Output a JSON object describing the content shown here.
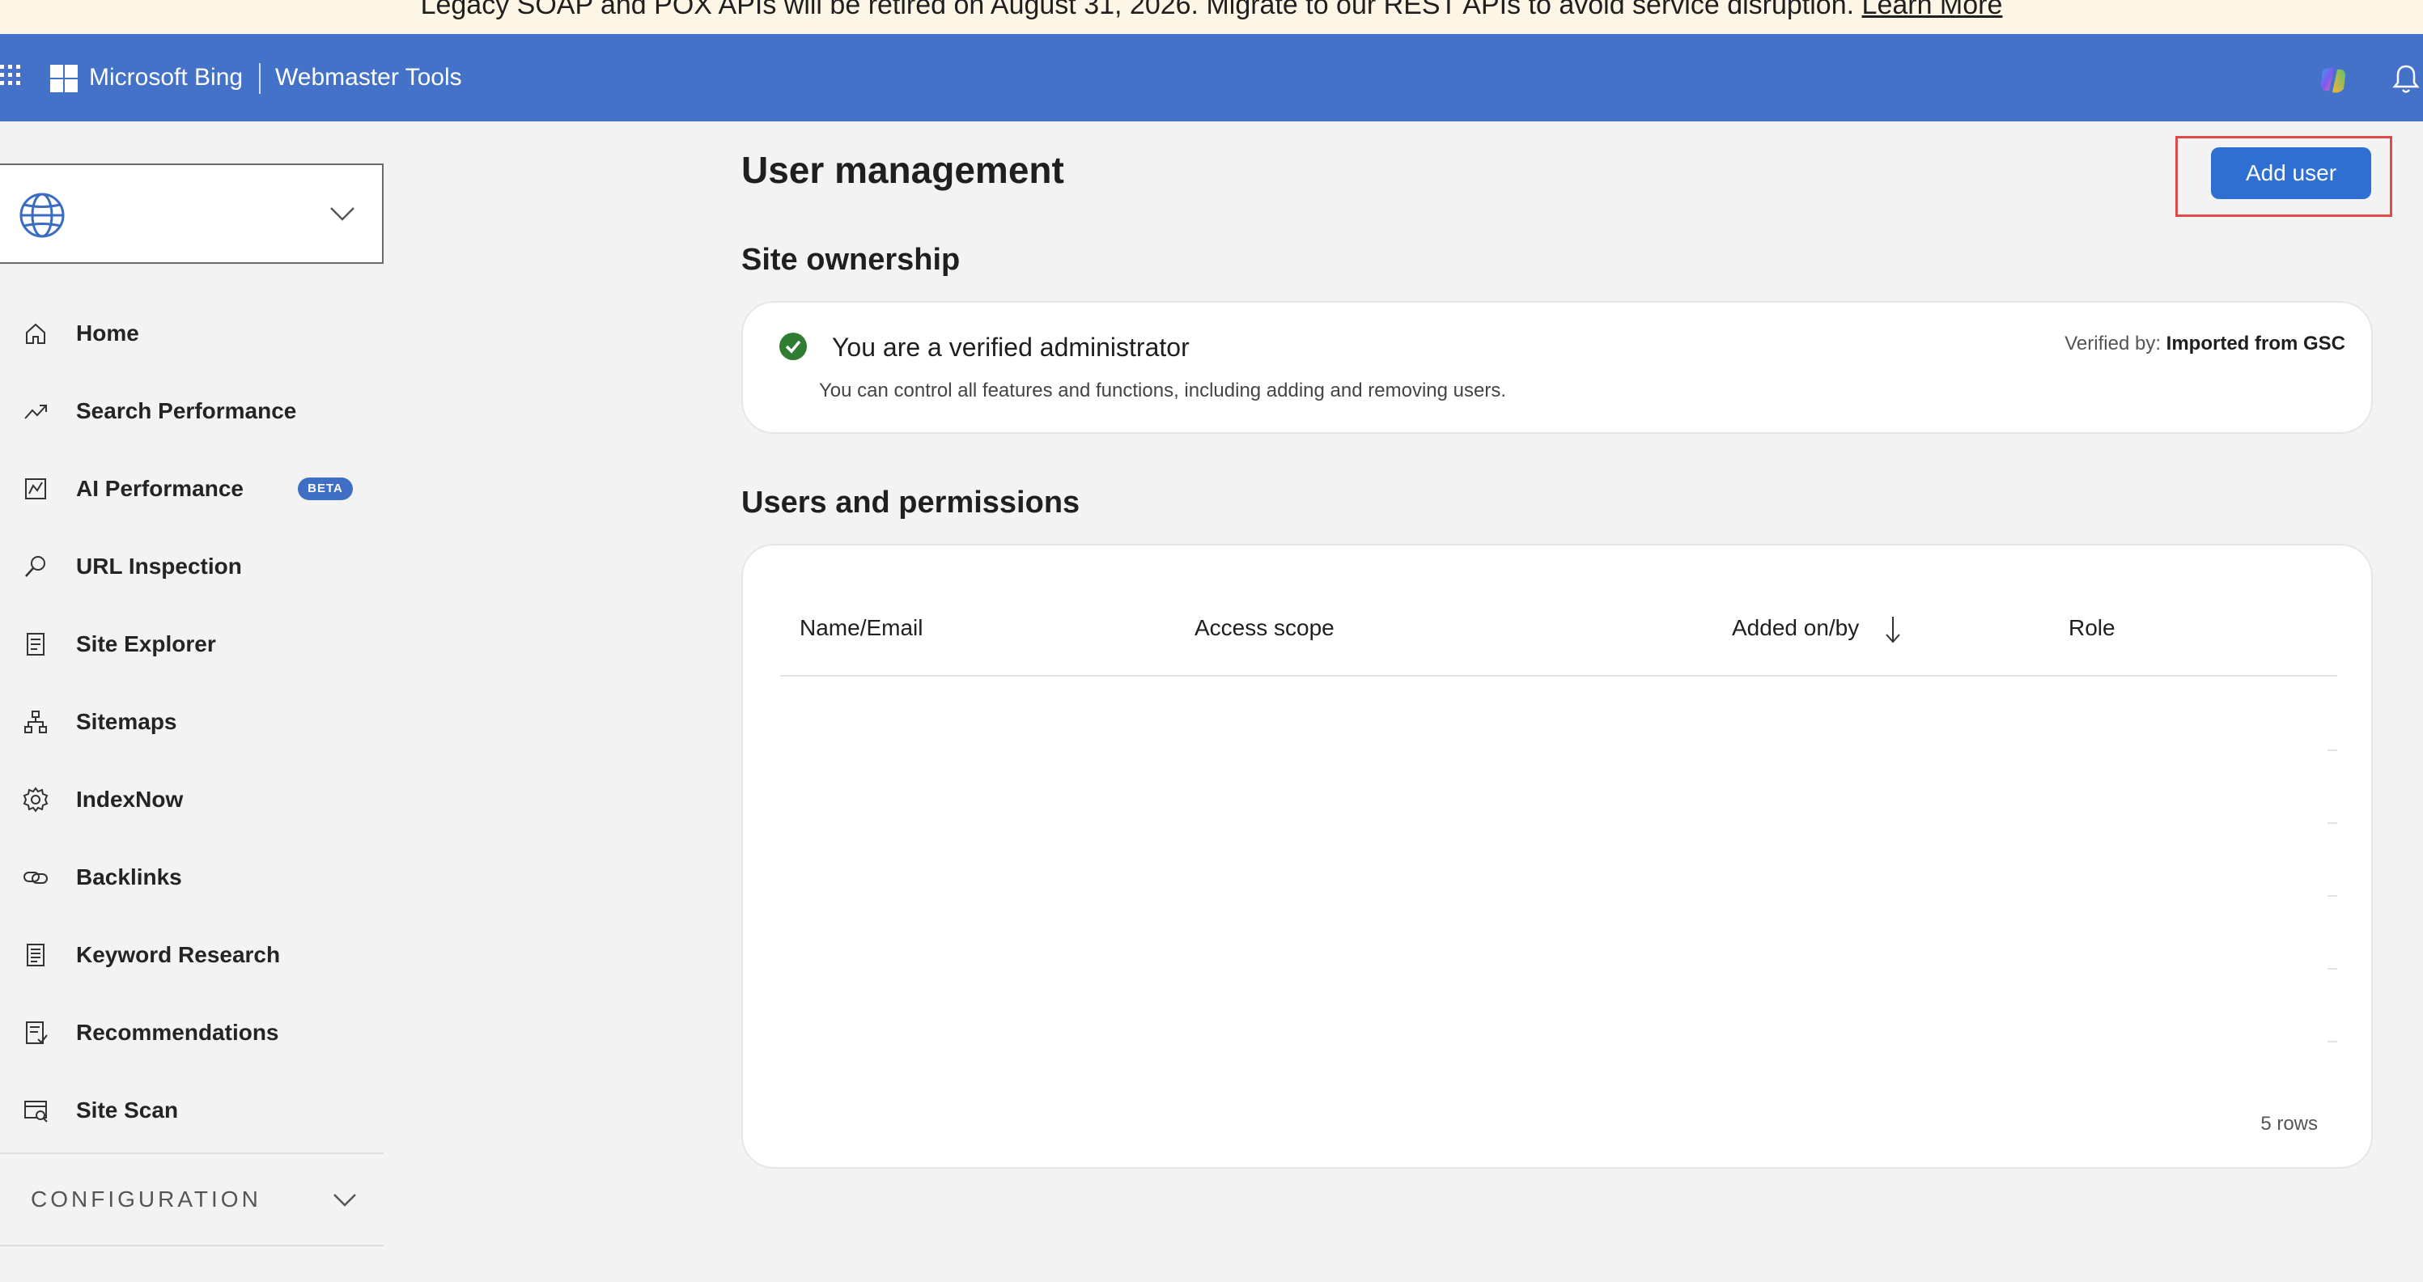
{
  "banner": {
    "text": "Legacy SOAP and POX APIs will be retired on August 31, 2026. Migrate to our REST APIs to avoid service disruption.",
    "link": "Learn More"
  },
  "header": {
    "brand": "Microsoft Bing",
    "product": "Webmaster Tools",
    "color": "#4472c8"
  },
  "sidebar": {
    "items": [
      {
        "label": "Home",
        "icon": "home-icon"
      },
      {
        "label": "Search Performance",
        "icon": "trend-icon"
      },
      {
        "label": "AI Performance",
        "icon": "chart-icon",
        "badge": "BETA"
      },
      {
        "label": "URL Inspection",
        "icon": "search-icon"
      },
      {
        "label": "Site Explorer",
        "icon": "document-icon"
      },
      {
        "label": "Sitemaps",
        "icon": "sitemap-icon"
      },
      {
        "label": "IndexNow",
        "icon": "gear-icon"
      },
      {
        "label": "Backlinks",
        "icon": "link-icon"
      },
      {
        "label": "Keyword Research",
        "icon": "notes-icon"
      },
      {
        "label": "Recommendations",
        "icon": "checklist-icon"
      },
      {
        "label": "Site Scan",
        "icon": "scan-icon"
      }
    ],
    "config_label": "CONFIGURATION"
  },
  "main": {
    "title": "User management",
    "add_user_label": "Add user",
    "ownership": {
      "heading": "Site ownership",
      "status": "You are a verified administrator",
      "description": "You can control all features and functions, including adding and removing users.",
      "verified_label": "Verified by:",
      "verified_value": "Imported from GSC"
    },
    "users": {
      "heading": "Users and permissions",
      "columns": [
        "Name/Email",
        "Access scope",
        "Added on/by",
        "Role"
      ],
      "row_count": "5 rows"
    }
  },
  "colors": {
    "accent": "#2f6fd1",
    "success": "#2e7d32",
    "highlight_outline": "#e04a4a"
  }
}
